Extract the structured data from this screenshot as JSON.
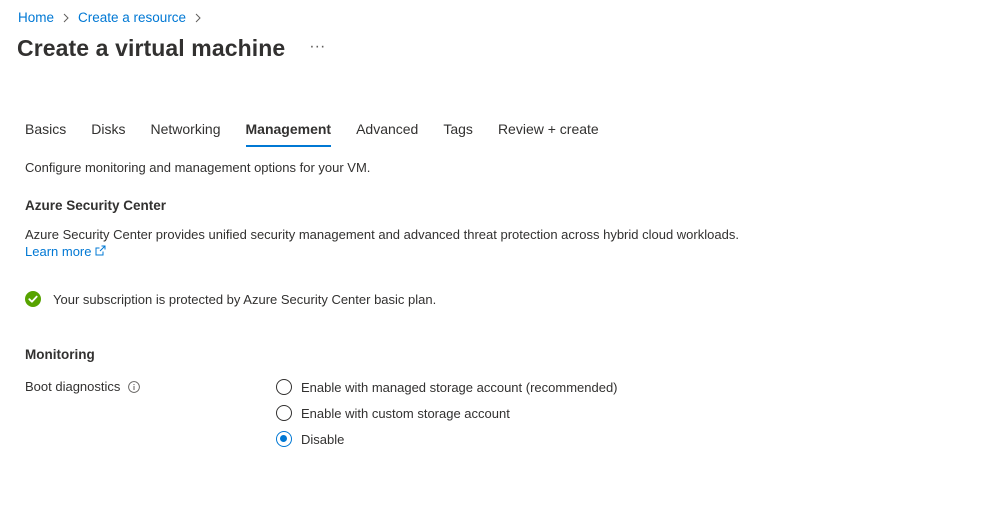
{
  "breadcrumb": {
    "items": [
      "Home",
      "Create a resource"
    ]
  },
  "title": "Create a virtual machine",
  "more_label": "···",
  "tabs": [
    {
      "label": "Basics",
      "active": false
    },
    {
      "label": "Disks",
      "active": false
    },
    {
      "label": "Networking",
      "active": false
    },
    {
      "label": "Management",
      "active": true
    },
    {
      "label": "Advanced",
      "active": false
    },
    {
      "label": "Tags",
      "active": false
    },
    {
      "label": "Review + create",
      "active": false
    }
  ],
  "intro": "Configure monitoring and management options for your VM.",
  "security": {
    "heading": "Azure Security Center",
    "description": "Azure Security Center provides unified security management and advanced threat protection across hybrid cloud workloads.",
    "learn_more": "Learn more",
    "status": "Your subscription is protected by Azure Security Center basic plan."
  },
  "monitoring": {
    "heading": "Monitoring",
    "boot_label": "Boot diagnostics",
    "options": [
      {
        "label": "Enable with managed storage account (recommended)",
        "checked": false
      },
      {
        "label": "Enable with custom storage account",
        "checked": false
      },
      {
        "label": "Disable",
        "checked": true
      }
    ]
  },
  "colors": {
    "accent": "#0078d4",
    "success": "#57a300",
    "text": "#323130"
  },
  "icons": {
    "breadcrumb_separator": "chevron-right-icon",
    "external_link": "external-link-icon",
    "status": "check-circle-icon",
    "info": "info-icon"
  }
}
